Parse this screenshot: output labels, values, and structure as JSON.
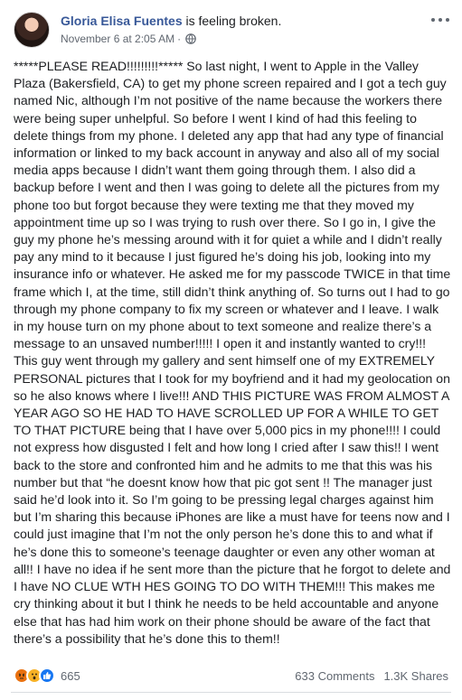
{
  "header": {
    "name": "Gloria Elisa Fuentes",
    "feeling": "is  feeling broken.",
    "timestamp": "November 6 at 2:05 AM",
    "separator": "·"
  },
  "post": {
    "text": "*****PLEASE READ!!!!!!!!!***** So last night, I went to Apple in the Valley Plaza (Bakersfield, CA) to get my phone screen repaired and I got a tech guy named Nic, although I’m not positive of the name because the workers there were being super unhelpful. So before I went I kind of had this feeling to delete things from my phone. I deleted any app that had any type of financial information or linked to my back account in anyway and also all of my social media apps because I didn’t want them going through them. I also did a backup before I went and then I was going to delete all the pictures from my phone too but forgot because they were texting me that they moved my appointment time up so I was trying to rush over there. So I go in, I give the guy my phone he’s messing around with it for quiet a while and I didn’t really pay any mind to it because I just figured he’s doing his job, looking into my insurance info or whatever. He asked me for my passcode TWICE in that time frame which I, at the time, still didn’t think anything of. So turns out I had to go through my phone company to fix my screen or whatever and I leave. I walk in my house turn on my phone about to text someone and realize there’s a message to an unsaved number!!!!! I open it and instantly wanted to cry!!! This guy went through my gallery and sent himself one of my EXTREMELY PERSONAL pictures that I took for my boyfriend and it had my geolocation on so he also knows where I live!!! AND THIS PICTURE WAS FROM ALMOST A YEAR AGO SO HE HAD TO HAVE SCROLLED UP FOR A WHILE TO GET TO THAT PICTURE being that I have over 5,000 pics in my phone!!!! I could not express how disgusted I felt and how long I cried after I saw this!! I went back to the store and confronted him and he admits to me that this was his number but that “he doesnt know how that pic got sent      !! The manager just said he’d look into it. So I’m going to be pressing legal charges against him but I’m sharing this because iPhones are like a must have for teens now and I could just imagine that I’m not the only person he’s done this to and what if he’s done this to someone’s teenage daughter or even any other woman at all!! I have no idea if he sent more than the picture that he forgot to delete and I have NO CLUE WTH HES GOING TO DO WITH THEM!!! This makes me cry thinking about it but I think he needs to be held accountable and anyone else that has had him work on their phone should be aware of the fact that there’s a possibility that he’s done this to them!!"
  },
  "footer": {
    "reaction_count": "665",
    "comments": "633 Comments",
    "shares": "1.3K Shares",
    "reaction_icons": [
      "angry-icon",
      "wow-icon",
      "like-icon"
    ]
  },
  "colors": {
    "name": "#385898",
    "meta": "#606770",
    "like": "#1877f2",
    "angry": "#e9710f",
    "wow": "#f7b125"
  }
}
